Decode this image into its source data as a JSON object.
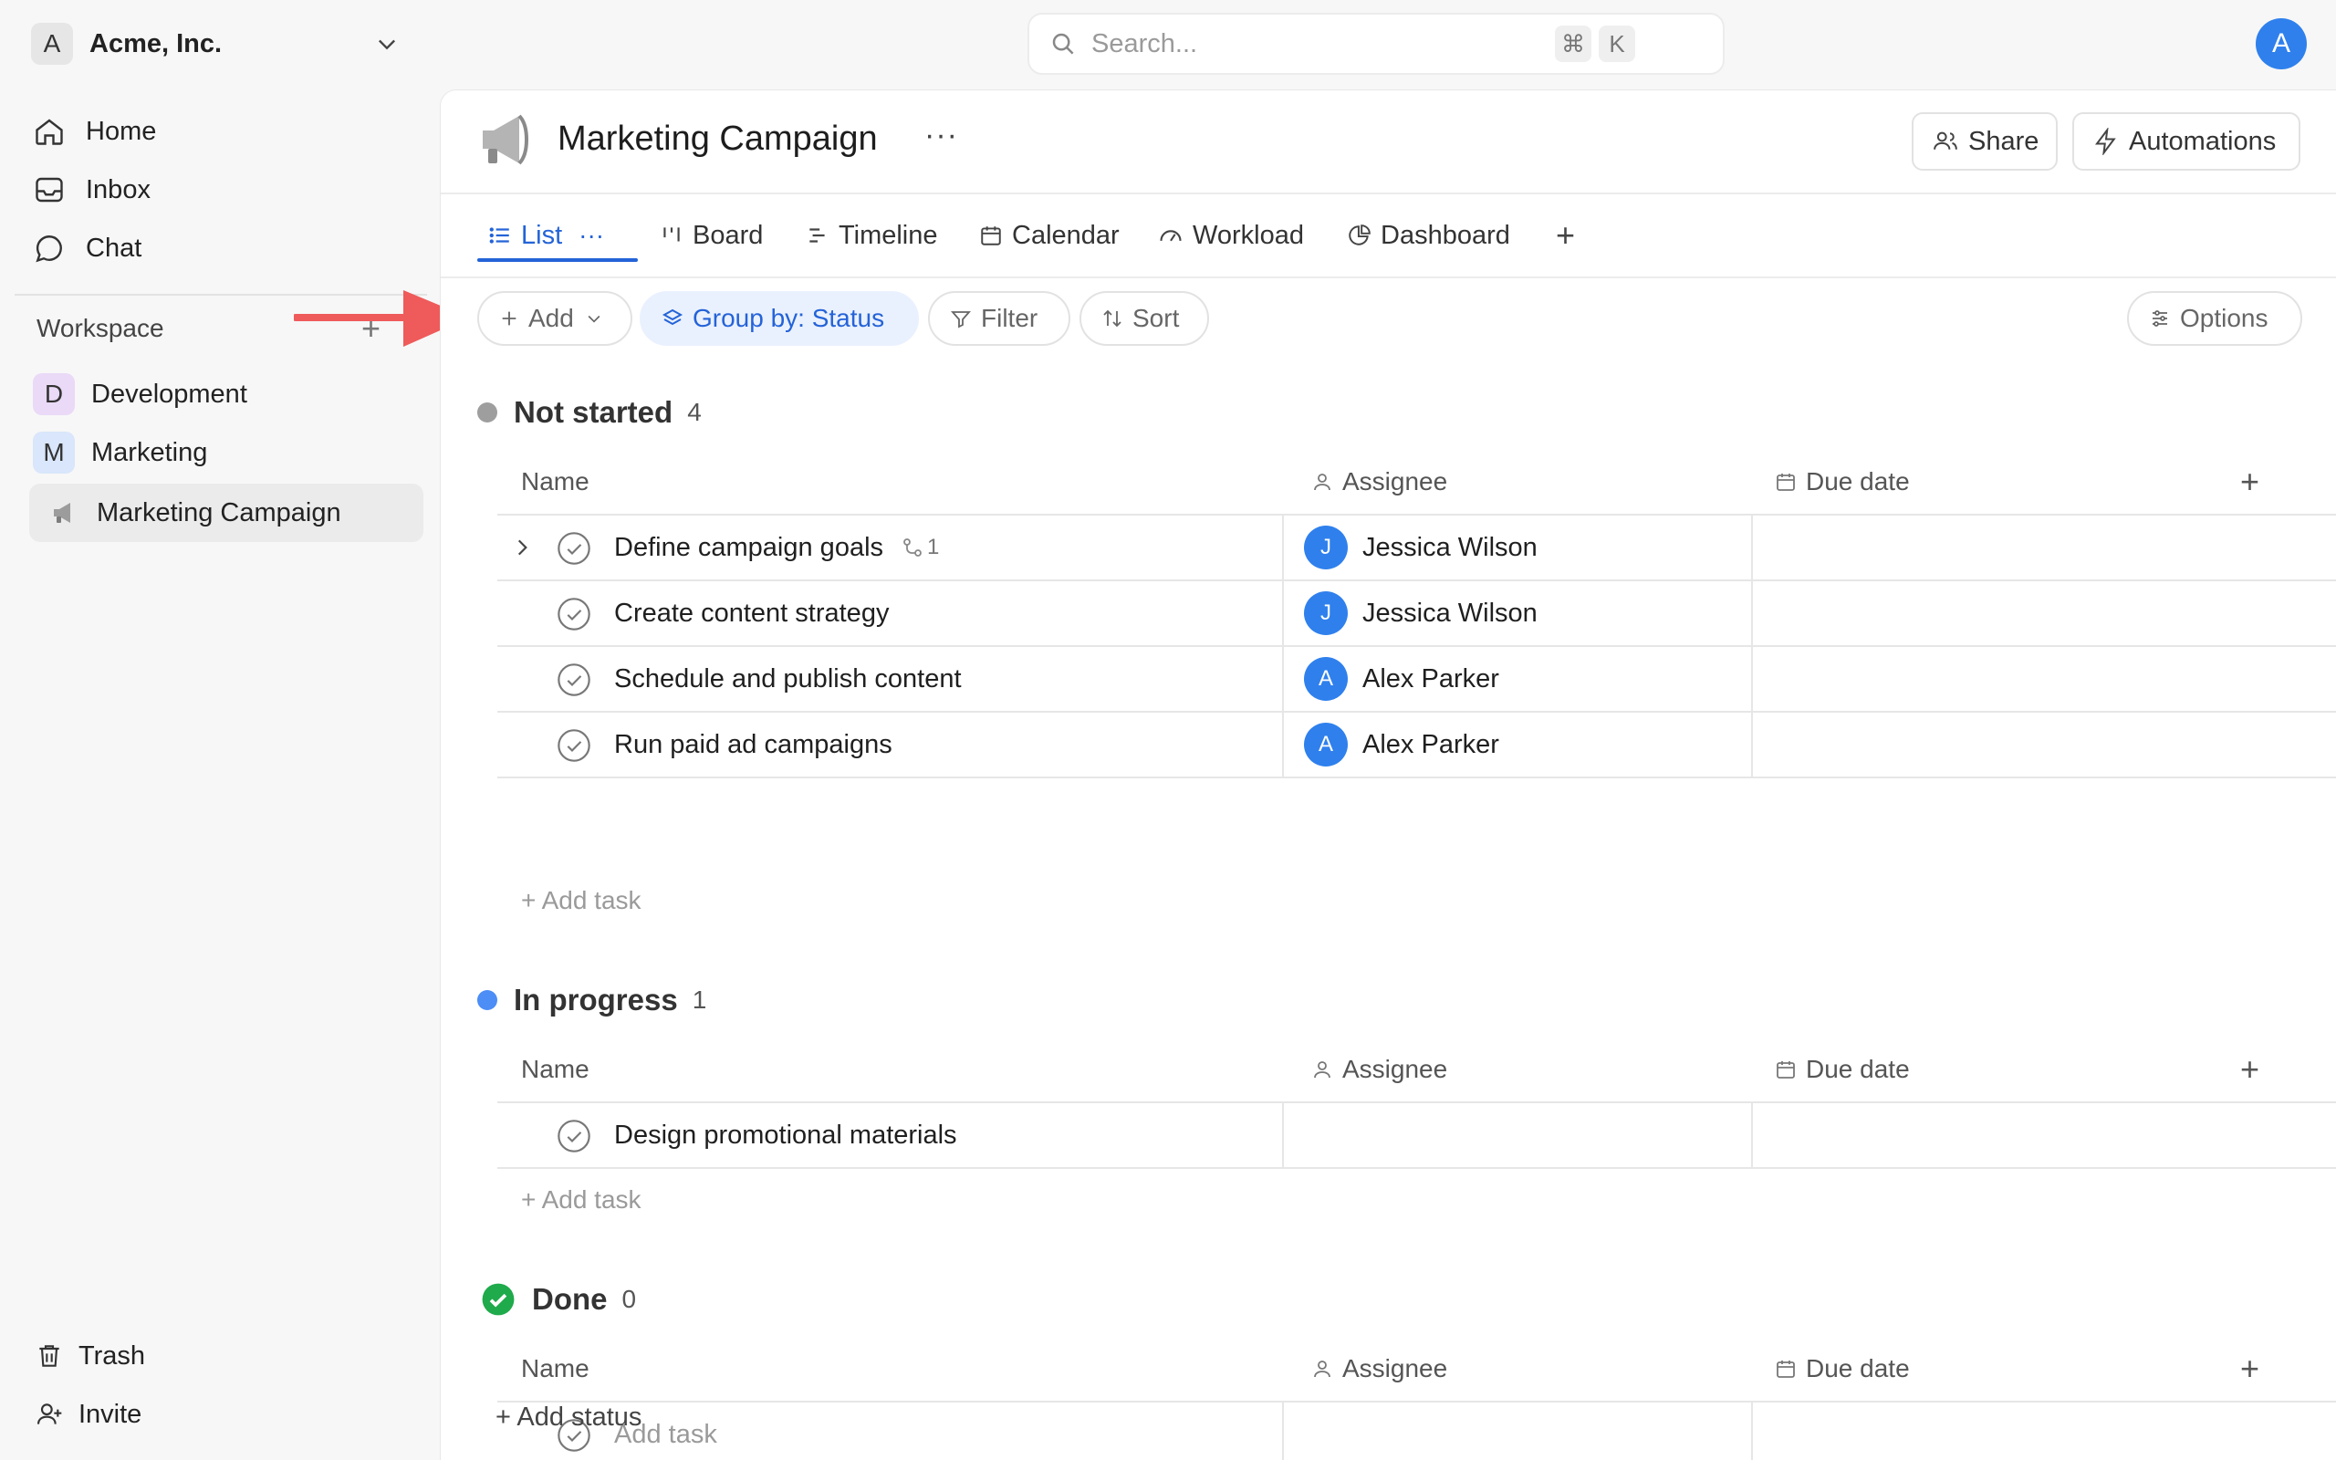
{
  "workspace_switcher": {
    "badge": "A",
    "name": "Acme, Inc."
  },
  "nav": [
    {
      "label": "Home",
      "icon": "home-icon"
    },
    {
      "label": "Inbox",
      "icon": "inbox-icon"
    },
    {
      "label": "Chat",
      "icon": "chat-icon"
    }
  ],
  "workspace": {
    "title": "Workspace",
    "spaces": [
      {
        "badge": "D",
        "label": "Development",
        "color": "#ead9f7"
      },
      {
        "badge": "M",
        "label": "Marketing",
        "color": "#d9e6fb"
      }
    ],
    "active_page": "Marketing Campaign"
  },
  "sidebar_bottom": [
    {
      "label": "Trash",
      "icon": "trash-icon"
    },
    {
      "label": "Invite",
      "icon": "invite-icon"
    }
  ],
  "search": {
    "placeholder": "Search...",
    "shortcut_1": "⌘",
    "shortcut_2": "K"
  },
  "user_avatar": "A",
  "page": {
    "title": "Marketing Campaign",
    "more": "···",
    "share_label": "Share",
    "automations_label": "Automations"
  },
  "tabs": [
    {
      "label": "List",
      "active": true,
      "more": "···"
    },
    {
      "label": "Board"
    },
    {
      "label": "Timeline"
    },
    {
      "label": "Calendar"
    },
    {
      "label": "Workload"
    },
    {
      "label": "Dashboard"
    },
    {
      "label": "+"
    }
  ],
  "toolbar": {
    "add": "Add",
    "group_by": "Group by: Status",
    "filter": "Filter",
    "sort": "Sort",
    "options": "Options"
  },
  "columns": {
    "name": "Name",
    "assignee": "Assignee",
    "due_date": "Due date"
  },
  "groups": [
    {
      "name": "Not started",
      "count": "4",
      "color": "#9e9e9e",
      "tasks": [
        {
          "name": "Define campaign goals",
          "subtasks": "1",
          "assignee": "Jessica Wilson",
          "initial": "J"
        },
        {
          "name": "Create content strategy",
          "assignee": "Jessica Wilson",
          "initial": "J"
        },
        {
          "name": "Schedule and publish content",
          "assignee": "Alex Parker",
          "initial": "A"
        },
        {
          "name": "Run paid ad campaigns",
          "assignee": "Alex Parker",
          "initial": "A"
        }
      ],
      "add_task": "+ Add task"
    },
    {
      "name": "In progress",
      "count": "1",
      "color": "#4c8df6",
      "tasks": [
        {
          "name": "Design promotional materials"
        }
      ],
      "add_task": "+ Add task"
    },
    {
      "name": "Done",
      "count": "0",
      "color": "#1faa4b",
      "placeholder_task": "Add task"
    }
  ],
  "add_status": "+ Add status"
}
